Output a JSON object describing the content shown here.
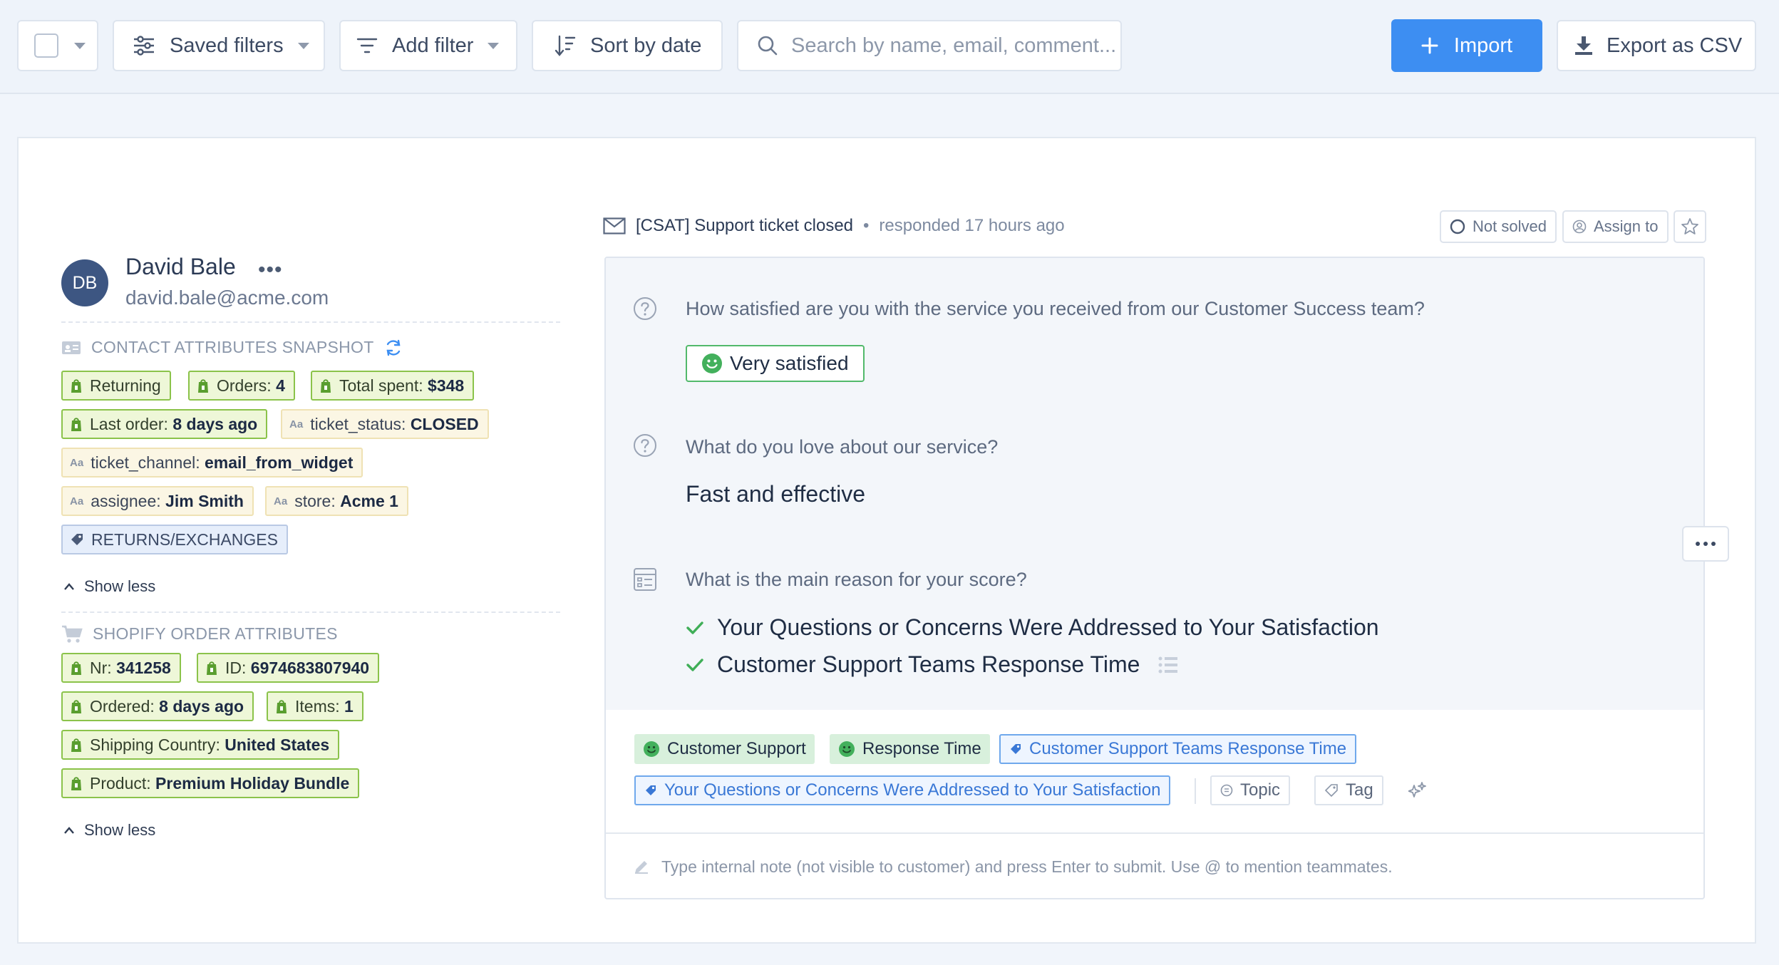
{
  "toolbar": {
    "saved_filters": "Saved filters",
    "add_filter": "Add filter",
    "sort": "Sort by date",
    "search_placeholder": "Search by name, email, comment...",
    "import": "Import",
    "export": "Export as CSV"
  },
  "contact": {
    "initials": "DB",
    "name": "David Bale",
    "email": "david.bale@acme.com",
    "attributes_title": "CONTACT ATTRIBUTES SNAPSHOT",
    "shopify_title": "SHOPIFY ORDER ATTRIBUTES",
    "show_less": "Show less",
    "attrs": {
      "returning": "Returning",
      "orders_key": "Orders:",
      "orders_val": "4",
      "spent_key": "Total spent:",
      "spent_val": "$348",
      "last_order_key": "Last order:",
      "last_order_val": "8 days ago",
      "ticket_status_key": "ticket_status:",
      "ticket_status_val": "CLOSED",
      "ticket_channel_key": "ticket_channel:",
      "ticket_channel_val": "email_from_widget",
      "assignee_key": "assignee:",
      "assignee_val": "Jim Smith",
      "store_key": "store:",
      "store_val": "Acme 1",
      "tag": "RETURNS/EXCHANGES"
    },
    "shopify": {
      "nr_key": "Nr:",
      "nr_val": "341258",
      "id_key": "ID:",
      "id_val": "6974683807940",
      "ordered_key": "Ordered:",
      "ordered_val": "8 days ago",
      "items_key": "Items:",
      "items_val": "1",
      "country_key": "Shipping Country:",
      "country_val": "United States",
      "product_key": "Product:",
      "product_val": "Premium Holiday Bundle"
    },
    "aa": "Aa"
  },
  "response": {
    "subject": "[CSAT] Support ticket closed",
    "meta": "responded 17 hours ago",
    "not_solved": "Not solved",
    "assign": "Assign to",
    "q1": "How satisfied are you with the service you received from our Customer Success team?",
    "a1": "Very satisfied",
    "q2": "What do you love about our service?",
    "a2": "Fast and effective",
    "q3": "What is the main reason for your score?",
    "a3_1": "Your Questions or Concerns Were Addressed to Your Satisfaction",
    "a3_2": "Customer Support Teams Response Time",
    "tags": {
      "t1": "Customer Support",
      "t2": "Response Time",
      "t3": "Customer Support Teams Response Time",
      "t4": "Your Questions or Concerns Were Addressed to Your Satisfaction",
      "topic": "Topic",
      "tag": "Tag"
    },
    "note_placeholder": "Type internal note (not visible to customer) and press Enter to submit. Use @ to mention teammates."
  },
  "colors": {
    "accent": "#3d8ef2",
    "shopify_green": "#8bc34a",
    "positive": "#52b96b"
  }
}
